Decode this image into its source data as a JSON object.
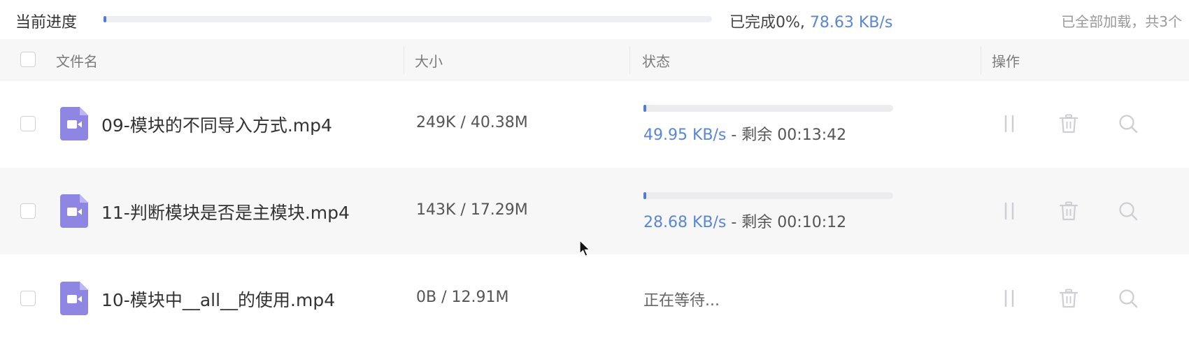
{
  "progress": {
    "label": "当前进度",
    "done_text": "已完成0%,",
    "speed": "78.63 KB/s",
    "percent": 0,
    "loaded_text": "已全部加载，共3个"
  },
  "header": {
    "col_name": "文件名",
    "col_size": "大小",
    "col_status": "状态",
    "col_action": "操作"
  },
  "files": [
    {
      "name": "09-模块的不同导入方式.mp4",
      "size": "249K / 40.38M",
      "progress": 0.006,
      "speed": "49.95 KB/s",
      "remaining": "- 剩余 00:13:42",
      "state": "downloading",
      "icon": "video-file-icon"
    },
    {
      "name": "11-判断模块是否是主模块.mp4",
      "size": "143K / 17.29M",
      "progress": 0.008,
      "speed": "28.68 KB/s",
      "remaining": "- 剩余 00:10:12",
      "state": "downloading",
      "icon": "video-file-icon"
    },
    {
      "name": "10-模块中__all__的使用.mp4",
      "size": "0B / 12.91M",
      "progress": 0,
      "waiting": "正在等待...",
      "state": "waiting",
      "icon": "video-file-icon"
    }
  ],
  "colors": {
    "accent": "#5a86d8",
    "file_icon": "#8f86e3",
    "row_alt": "#f7f7f8"
  },
  "actions": [
    "pause-icon",
    "trash-icon",
    "search-icon"
  ]
}
